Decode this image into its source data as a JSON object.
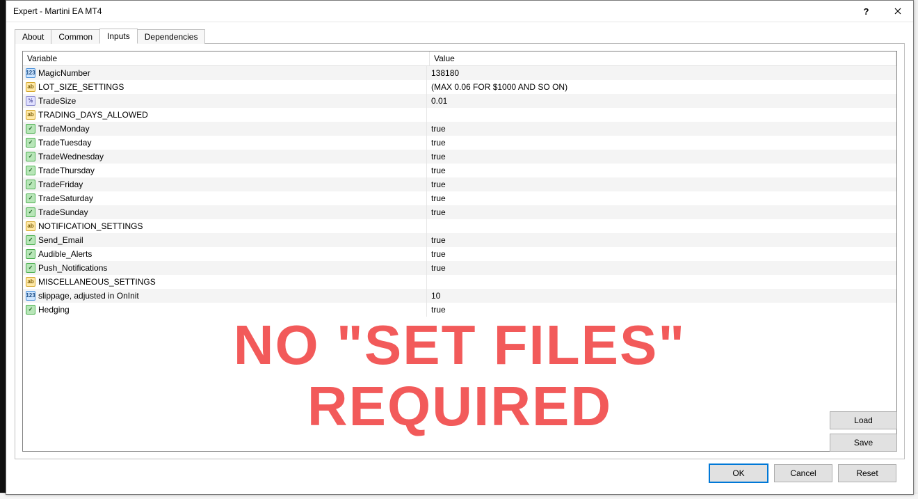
{
  "window": {
    "title": "Expert - Martini EA MT4"
  },
  "tabs": {
    "about": "About",
    "common": "Common",
    "inputs": "Inputs",
    "dependencies": "Dependencies"
  },
  "grid": {
    "header_variable": "Variable",
    "header_value": "Value",
    "rows": [
      {
        "icon": "int",
        "icon_label": "123",
        "name": "MagicNumber",
        "value": "138180"
      },
      {
        "icon": "str",
        "icon_label": "ab",
        "name": "LOT_SIZE_SETTINGS",
        "value": "(MAX 0.06 FOR $1000 AND SO ON)"
      },
      {
        "icon": "dbl",
        "icon_label": "½",
        "name": "TradeSize",
        "value": "0.01"
      },
      {
        "icon": "str",
        "icon_label": "ab",
        "name": "TRADING_DAYS_ALLOWED",
        "value": ""
      },
      {
        "icon": "bool",
        "icon_label": "✓",
        "name": "TradeMonday",
        "value": "true"
      },
      {
        "icon": "bool",
        "icon_label": "✓",
        "name": "TradeTuesday",
        "value": "true"
      },
      {
        "icon": "bool",
        "icon_label": "✓",
        "name": "TradeWednesday",
        "value": "true"
      },
      {
        "icon": "bool",
        "icon_label": "✓",
        "name": "TradeThursday",
        "value": "true"
      },
      {
        "icon": "bool",
        "icon_label": "✓",
        "name": "TradeFriday",
        "value": "true"
      },
      {
        "icon": "bool",
        "icon_label": "✓",
        "name": "TradeSaturday",
        "value": "true"
      },
      {
        "icon": "bool",
        "icon_label": "✓",
        "name": "TradeSunday",
        "value": "true"
      },
      {
        "icon": "str",
        "icon_label": "ab",
        "name": "NOTIFICATION_SETTINGS",
        "value": ""
      },
      {
        "icon": "bool",
        "icon_label": "✓",
        "name": "Send_Email",
        "value": "true"
      },
      {
        "icon": "bool",
        "icon_label": "✓",
        "name": "Audible_Alerts",
        "value": "true"
      },
      {
        "icon": "bool",
        "icon_label": "✓",
        "name": "Push_Notifications",
        "value": "true"
      },
      {
        "icon": "str",
        "icon_label": "ab",
        "name": "MISCELLANEOUS_SETTINGS",
        "value": ""
      },
      {
        "icon": "int",
        "icon_label": "123",
        "name": "slippage, adjusted in OnInit",
        "value": "10"
      },
      {
        "icon": "bool",
        "icon_label": "✓",
        "name": "Hedging",
        "value": "true"
      }
    ]
  },
  "overlay": {
    "line1": "NO \"SET FILES\"",
    "line2": "REQUIRED"
  },
  "buttons": {
    "load": "Load",
    "save": "Save",
    "ok": "OK",
    "cancel": "Cancel",
    "reset": "Reset"
  }
}
